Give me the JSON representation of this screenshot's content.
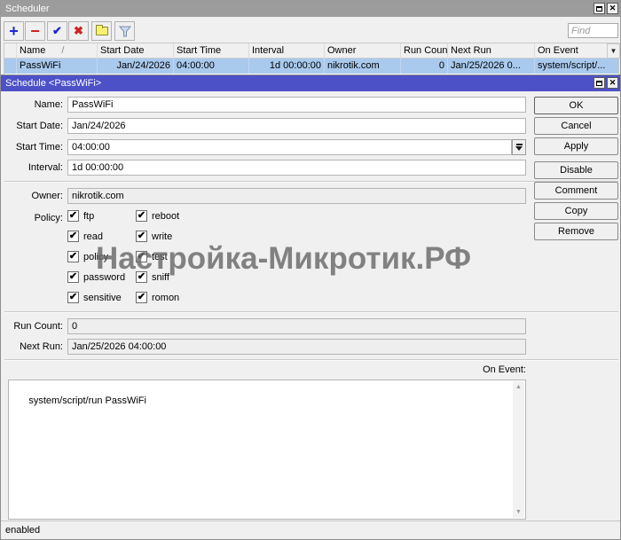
{
  "icons": {
    "add": "+",
    "remove": "−",
    "enable": "✔",
    "disable": "✖",
    "close": "✕",
    "sort_asc": "/",
    "dropdown": "▼",
    "check": "✔",
    "scroll_up": "▲",
    "scroll_down": "▼"
  },
  "colors": {
    "active_titlebar": "#4d51c8",
    "inactive_titlebar": "#9c9c9c",
    "selected_row": "#a9c9ed",
    "toolbar_add": "#2026d2",
    "toolbar_remove": "#d02020",
    "watermark": "#666666"
  },
  "scheduler_window": {
    "title": "Scheduler",
    "find_placeholder": "Find",
    "table": {
      "columns": [
        "Name",
        "Start Date",
        "Start Time",
        "Interval",
        "Owner",
        "Run Count",
        "Next Run",
        "On Event"
      ],
      "row": {
        "name": "PassWiFi",
        "start_date": "Jan/24/2026",
        "start_time": "04:00:00",
        "interval": "1d 00:00:00",
        "owner": "nikrotik.com",
        "run_count": "0",
        "next_run": "Jan/25/2026 0...",
        "on_event": "system/script/..."
      }
    }
  },
  "dialog": {
    "title": "Schedule <PassWiFi>",
    "labels": {
      "name": "Name:",
      "start_date": "Start Date:",
      "start_time": "Start Time:",
      "interval": "Interval:",
      "owner": "Owner:",
      "policy": "Policy:",
      "run_count": "Run Count:",
      "next_run": "Next Run:",
      "on_event": "On Event:"
    },
    "values": {
      "name": "PassWiFi",
      "start_date": "Jan/24/2026",
      "start_time": "04:00:00",
      "interval": "1d 00:00:00",
      "owner": "nikrotik.com",
      "run_count": "0",
      "next_run": "Jan/25/2026 04:00:00",
      "on_event": "system/script/run PassWiFi"
    },
    "policy": {
      "column1": [
        {
          "label": "ftp",
          "checked": true
        },
        {
          "label": "read",
          "checked": true
        },
        {
          "label": "policy",
          "checked": true
        },
        {
          "label": "password",
          "checked": true
        },
        {
          "label": "sensitive",
          "checked": true
        }
      ],
      "column2": [
        {
          "label": "reboot",
          "checked": true
        },
        {
          "label": "write",
          "checked": true
        },
        {
          "label": "test",
          "checked": true
        },
        {
          "label": "sniff",
          "checked": true
        },
        {
          "label": "romon",
          "checked": true
        }
      ]
    },
    "buttons": [
      "OK",
      "Cancel",
      "Apply",
      "Disable",
      "Comment",
      "Copy",
      "Remove"
    ],
    "status": "enabled"
  },
  "watermark": "Настройка-Микротик.РФ"
}
